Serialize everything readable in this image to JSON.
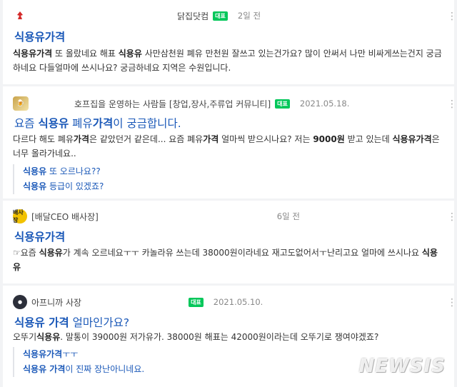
{
  "colors": {
    "title_blue": "#1a58b8",
    "badge_green": "#03c75a",
    "background": "#f2f3f5"
  },
  "badge_label": "대표",
  "more_icon": "more-vertical-icon",
  "posts": [
    {
      "cafe": "닭집닷컴",
      "date": "2일 전",
      "avatar_icon": "chicken-logo-icon",
      "title": "식용유가격",
      "snippet_1": {
        "b1": "식용유가격",
        "t1": " 또 올랐네요 해표 ",
        "b2": "식용유",
        "t2": " 사만삼천원 폐유 만천원 잘쓰고 있는건가요? 많이 안써서 나만 비싸게쓰는건지 궁금하네요 다들얼마에 쓰시나요? 궁금하네요 지역은 수원입니다."
      }
    },
    {
      "cafe": "호프집을 운영하는 사람들 [창업,장사,주류업 커뮤니티]",
      "date": "2021.05.18.",
      "avatar_icon": "hof-logo-icon",
      "title_pre": "요즘 ",
      "title_b1": "식용유",
      "title_mid": " 폐유",
      "title_b2": "가격",
      "title_post": "이 궁금합니다.",
      "snippet": {
        "t1": "다르다 해도 폐유",
        "b1": "가격",
        "t2": "은 같았던거 같은데... 요즘 폐유",
        "b2": "가격",
        "t3": " 얼마씩 받으시나요? 저는 ",
        "b3": "9000원",
        "t4": " 받고 있는데 ",
        "b4": "식용유가격",
        "t5": "은 너무 올라가네요.."
      },
      "subs": [
        {
          "b": "식용유",
          "t": " 또 오르나요??"
        },
        {
          "b": "식용유",
          "t": " 등급이 있겠죠?"
        }
      ]
    },
    {
      "cafe": "[배달CEO 배사장]",
      "date": "6일 전",
      "avatar_icon": "baesajang-logo-icon",
      "avatar_text": "배사장",
      "title": "식용유가격",
      "snippet": {
        "t1": "☞요즘 ",
        "b1": "식용유",
        "t2": "가 계속 오르네요ㅜㅜ 카놀라유 쓰는데 38000원이라네요 재고도없어서ㅜ난리고요 얼마에 쓰시나요 ",
        "b2": "식용유"
      }
    },
    {
      "cafe": "아프니까 사장",
      "date": "2021.05.10.",
      "avatar_icon": "apeunikka-logo-icon",
      "title_b1": "식용유 가격",
      "title_post": " 얼마인가요?",
      "snippet": {
        "t1": "오뚜기",
        "b1": "식용유",
        "t2": ". 말통이 39000원 저가유가. 38000원 해표는 42000원이라는데 오뚜기로 쟁여야겠죠?"
      },
      "subs": [
        {
          "b": "식용유가격",
          "t": "ㅜㅜ"
        },
        {
          "b": "식용유 가격",
          "t": "이 진짜 장난아니네요."
        }
      ]
    }
  ],
  "watermark": "NEWSIS"
}
